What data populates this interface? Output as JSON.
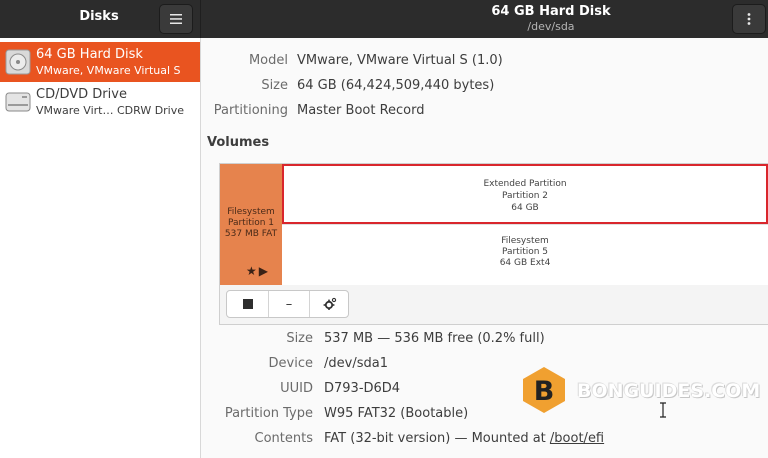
{
  "header": {
    "app_title": "Disks",
    "disk_title": "64 GB Hard Disk",
    "disk_path": "/dev/sda",
    "menu_icon": "hamburger-menu-icon",
    "kebab_icon": "vertical-dots-icon"
  },
  "sidebar": {
    "items": [
      {
        "name": "64 GB Hard Disk",
        "subtitle": "VMware, VMware Virtual S",
        "icon": "hard-disk-icon",
        "selected": true
      },
      {
        "name": "CD/DVD Drive",
        "subtitle": "VMware Virt… CDRW Drive",
        "icon": "optical-drive-icon",
        "selected": false
      }
    ]
  },
  "disk_info": {
    "model_label": "Model",
    "model_value": "VMware, VMware Virtual S (1.0)",
    "size_label": "Size",
    "size_value": "64 GB (64,424,509,440 bytes)",
    "partitioning_label": "Partitioning",
    "partitioning_value": "Master Boot Record"
  },
  "volumes": {
    "heading": "Volumes",
    "partition1": {
      "line1": "Filesystem",
      "line2": "Partition 1",
      "line3": "537 MB FAT"
    },
    "extended": {
      "line1": "Extended Partition",
      "line2": "Partition 2",
      "line3": "64 GB"
    },
    "logical": {
      "line1": "Filesystem",
      "line2": "Partition 5",
      "line3": "64 GB Ext4"
    }
  },
  "toolbar": {
    "stop_icon": "stop-icon",
    "minus_label": "–",
    "gear_icon": "gear-icon"
  },
  "volume_info": {
    "size_label": "Size",
    "size_value": "537 MB — 536 MB free (0.2% full)",
    "device_label": "Device",
    "device_value": "/dev/sda1",
    "uuid_label": "UUID",
    "uuid_value": "D793-D6D4",
    "type_label": "Partition Type",
    "type_value": "W95 FAT32 (Bootable)",
    "contents_label": "Contents",
    "contents_value": "FAT (32-bit version) — Mounted at ",
    "mount_point": "/boot/efi"
  },
  "watermark": {
    "text": "BONGUIDES.COM",
    "badge_letter": "B"
  },
  "colors": {
    "accent": "#e95420",
    "header_bg": "#2c2c2c",
    "partition_fat": "#e6834d",
    "highlight_box": "#d9262c"
  }
}
